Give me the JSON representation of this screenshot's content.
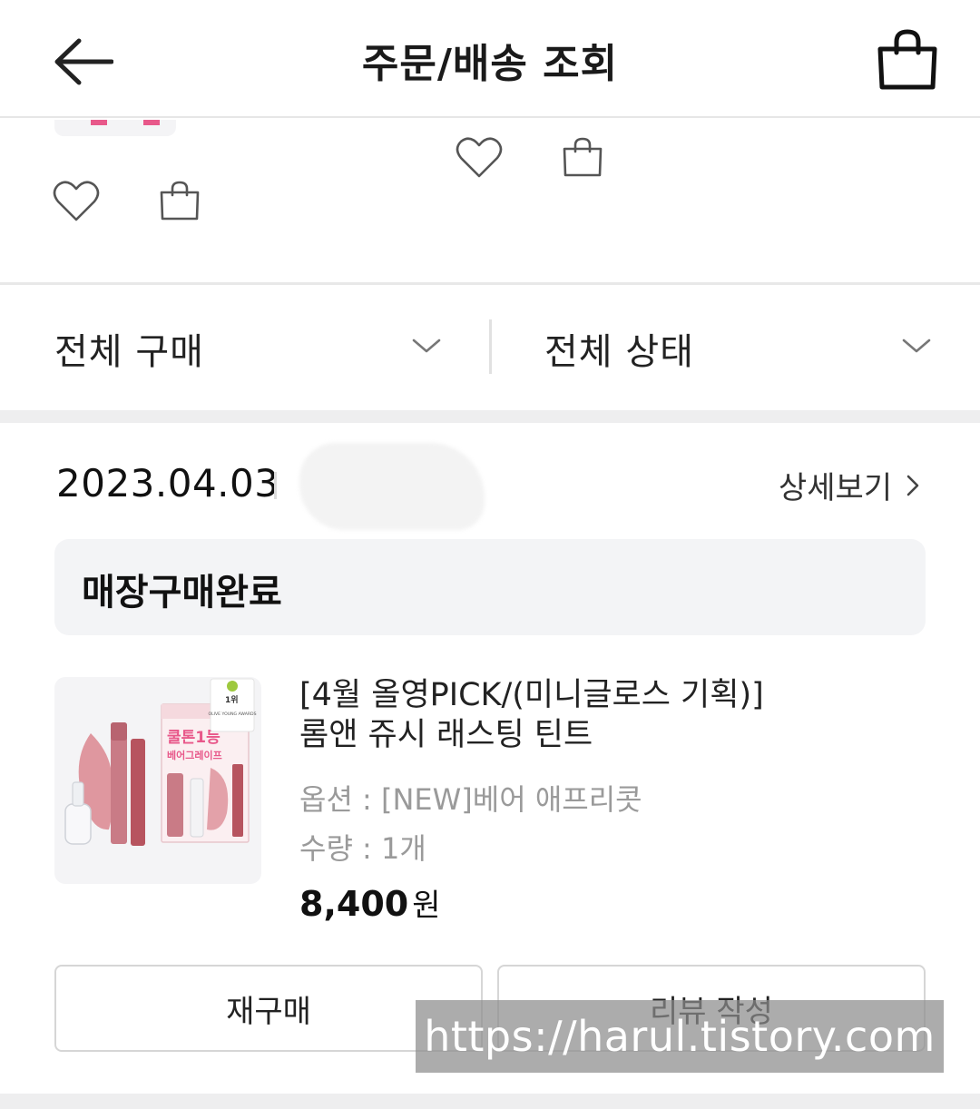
{
  "header": {
    "title": "주문/배송 조회",
    "back_icon": "arrow-left-icon",
    "cart_icon": "shopping-bag-icon"
  },
  "filters": {
    "purchase_type": {
      "selected": "전체 구매"
    },
    "status": {
      "selected": "전체 상태"
    }
  },
  "order": {
    "date": "2023.04.03",
    "detail_label": "상세보기",
    "status": "매장구매완료",
    "product": {
      "name_line1": "[4월 올영PICK/(미니글로스 기획)]",
      "name_line2": "롬앤 쥬시 래스팅 틴트",
      "option": "옵션 : [NEW]베어 애프리콧",
      "quantity": "수량 : 1개",
      "price": "8,400",
      "currency": "원",
      "image_text": {
        "headline": "쿨톤1등",
        "subline": "베어그레이프",
        "badge": "1위",
        "badge_sub": "OLIVE YOUNG AWARDS"
      }
    },
    "buttons": {
      "rebuy": "재구매",
      "review": "리뷰 작성"
    }
  },
  "watermark": "https://harul.tistory.com",
  "colors": {
    "accent_pink": "#e8588a",
    "product_rose": "#c85a6a",
    "muted_text": "#9a9a9a",
    "status_bg": "#f3f4f6"
  }
}
